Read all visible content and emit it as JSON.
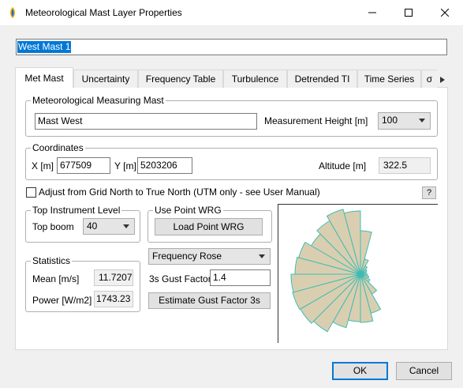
{
  "window": {
    "title": "Meteorological Mast Layer Properties"
  },
  "name_field": {
    "value": "West Mast 1"
  },
  "tabs": [
    {
      "label": "Met Mast"
    },
    {
      "label": "Uncertainty"
    },
    {
      "label": "Frequency Table"
    },
    {
      "label": "Turbulence"
    },
    {
      "label": "Detrended TI"
    },
    {
      "label": "Time Series"
    },
    {
      "label": "σ"
    }
  ],
  "mast": {
    "group_label": "Meteorological Measuring Mast",
    "name_value": "Mast West",
    "height_label": "Measurement Height [m]",
    "height_value": "100"
  },
  "coords": {
    "group_label": "Coordinates",
    "x_label": "X [m]",
    "x_value": "677509",
    "y_label": "Y [m]",
    "y_value": "5203206",
    "alt_label": "Altitude [m]",
    "alt_value": "322.5"
  },
  "adjust": {
    "label": "Adjust from Grid North to True North (UTM only - see User Manual)",
    "checked": false,
    "help": "?"
  },
  "top_instr": {
    "group_label": "Top Instrument Level",
    "boom_label": "Top boom",
    "boom_value": "40"
  },
  "wrg": {
    "group_label": "Use Point WRG",
    "load_label": "Load Point WRG"
  },
  "stats": {
    "group_label": "Statistics",
    "mean_label": "Mean [m/s]",
    "mean_value": "11.7207",
    "power_label": "Power [W/m2]",
    "power_value": "1743.23"
  },
  "rose": {
    "selector_value": "Frequency Rose",
    "fill": "#d9cfb0",
    "stroke": "#3fbcb4"
  },
  "gust": {
    "label": "3s Gust Factor",
    "value": "1.4",
    "button_label": "Estimate Gust Factor 3s"
  },
  "footer": {
    "ok": "OK",
    "cancel": "Cancel"
  },
  "colors": {
    "selection": "#0078d7",
    "ok_border": "#0078d7"
  }
}
